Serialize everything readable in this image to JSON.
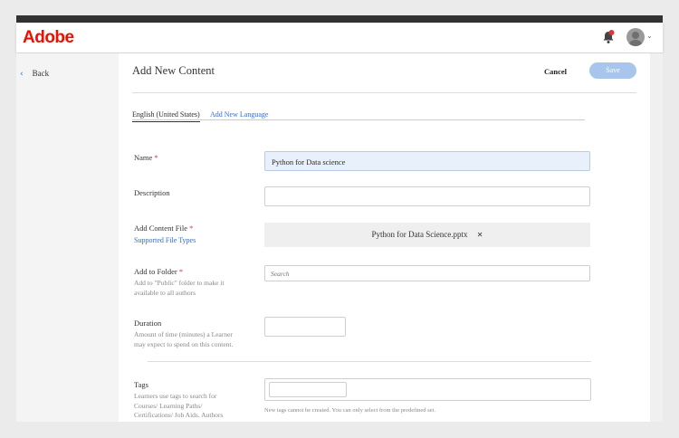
{
  "header": {
    "logo": "Adobe",
    "notification_badge": "1"
  },
  "sidebar": {
    "back_label": "Back"
  },
  "page": {
    "title": "Add New Content",
    "cancel_label": "Cancel",
    "save_label": "Save"
  },
  "tabs": [
    {
      "label": "English (United States)",
      "active": true
    },
    {
      "label": "Add New Language",
      "active": false
    }
  ],
  "form": {
    "name": {
      "label": "Name",
      "required": "*",
      "value": "Python for Data science"
    },
    "description": {
      "label": "Description",
      "value": ""
    },
    "content_file": {
      "label": "Add Content File",
      "required": "*",
      "link": "Supported File Types",
      "file_name": "Python for Data Science.pptx",
      "remove_icon": "✕"
    },
    "folder": {
      "label": "Add to Folder",
      "required": "*",
      "help": "Add to \"Public\" folder to make it available to all authors",
      "placeholder": "Search"
    },
    "duration": {
      "label": "Duration",
      "help": "Amount of time (minutes) a Learner may expect to spend on this content.",
      "value": ""
    },
    "tags": {
      "label": "Tags",
      "help": "Learners use tags to search for Courses/ Learning Paths/ Certifications/ Job Aids. Authors may type during Course creation",
      "note": "New tags cannot be created. You can only select from the predefined set."
    }
  },
  "colors": {
    "brand": "#eb1000",
    "link": "#2d6fd6",
    "save_disabled": "#a8c6ec",
    "name_field_bg": "#e8f0fb"
  }
}
